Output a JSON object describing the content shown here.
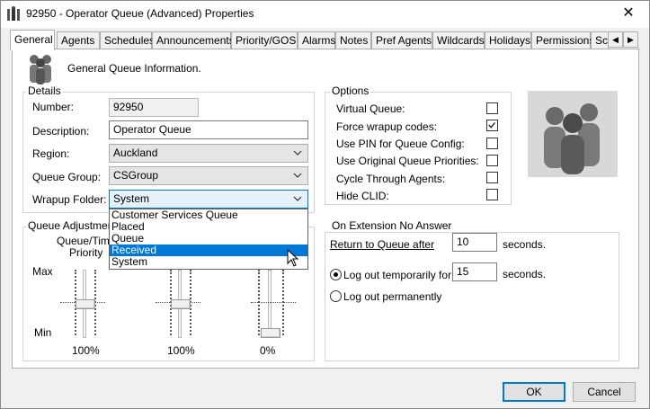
{
  "window": {
    "title": "92950 - Operator Queue (Advanced) Properties",
    "close_glyph": "✕"
  },
  "tabs": [
    "General",
    "Agents",
    "Schedules",
    "Announcements",
    "Priority/GOS",
    "Alarms",
    "Notes",
    "Pref Agents",
    "Wildcards",
    "Holidays",
    "Permissions",
    "Scr"
  ],
  "tab_arrows": {
    "left": "◀",
    "right": "▶"
  },
  "header": {
    "text": "General Queue Information."
  },
  "details": {
    "group_label": "Details",
    "number_label": "Number:",
    "number_value": "92950",
    "description_label": "Description:",
    "description_value": "Operator Queue",
    "region_label": "Region:",
    "region_value": "Auckland",
    "queue_group_label": "Queue Group:",
    "queue_group_value": "CSGroup",
    "wrapup_label": "Wrapup Folder:",
    "wrapup_value": "System",
    "wrapup_options": [
      "Customer Services Queue",
      "Placed",
      "Queue",
      "Received",
      "System"
    ],
    "wrapup_highlighted": "Received"
  },
  "options": {
    "group_label": "Options",
    "items": [
      {
        "label": "Virtual Queue:",
        "checked": false
      },
      {
        "label": "Force wrapup codes:",
        "checked": true
      },
      {
        "label": "Use PIN for Queue Config:",
        "checked": false
      },
      {
        "label": "Use Original Queue Priorities:",
        "checked": false
      },
      {
        "label": "Cycle Through Agents:",
        "checked": false
      },
      {
        "label": "Hide CLID:",
        "checked": false
      }
    ]
  },
  "queue_adjustments": {
    "group_label": "Queue Adjustments",
    "col1_label_line1": "Queue/Time",
    "col1_label_line2": "Priority",
    "max_label": "Max",
    "min_label": "Min",
    "sliders": [
      {
        "value_label": "100%",
        "level": 0.5
      },
      {
        "value_label": "100%",
        "level": 0.5
      },
      {
        "value_label": "0%",
        "level": 0.0
      }
    ]
  },
  "no_answer": {
    "group_label": "On Extension No Answer",
    "return_label": "Return to Queue after",
    "return_value": "10",
    "seconds1": "seconds.",
    "logout_temp_label": "Log out temporarily for",
    "logout_temp_value": "15",
    "seconds2": "seconds.",
    "logout_perm_label": "Log out permanently",
    "selected": "logout_temporarily"
  },
  "buttons": {
    "ok": "OK",
    "cancel": "Cancel"
  }
}
